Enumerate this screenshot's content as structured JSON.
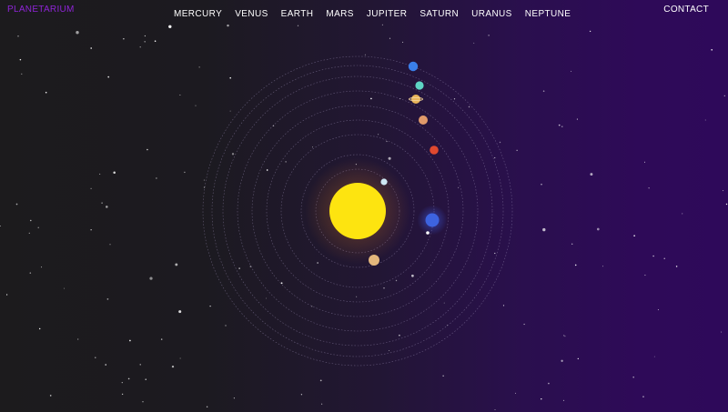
{
  "nav": {
    "brand": "PLANETARIUM",
    "links": [
      "MERCURY",
      "VENUS",
      "EARTH",
      "MARS",
      "JUPITER",
      "SATURN",
      "URANUS",
      "NEPTUNE"
    ],
    "contact": "CONTACT"
  },
  "colors": {
    "brand": "#8e24d6",
    "sun": "#fde410",
    "orbit": "#9c8fb8"
  },
  "solar_system": {
    "sun": {
      "name": "sun",
      "color": "#fde410",
      "glow": "#f5a623"
    },
    "planets": [
      {
        "name": "mercury",
        "color": "#cde6f2"
      },
      {
        "name": "venus",
        "color": "#e3b77c"
      },
      {
        "name": "earth",
        "color": "#3d63e0"
      },
      {
        "name": "mars",
        "color": "#e0492f"
      },
      {
        "name": "jupiter",
        "color": "#e09a6a"
      },
      {
        "name": "saturn",
        "color": "#e8b45a"
      },
      {
        "name": "uranus",
        "color": "#5ed4c4"
      },
      {
        "name": "neptune",
        "color": "#3a7ee8"
      }
    ]
  }
}
